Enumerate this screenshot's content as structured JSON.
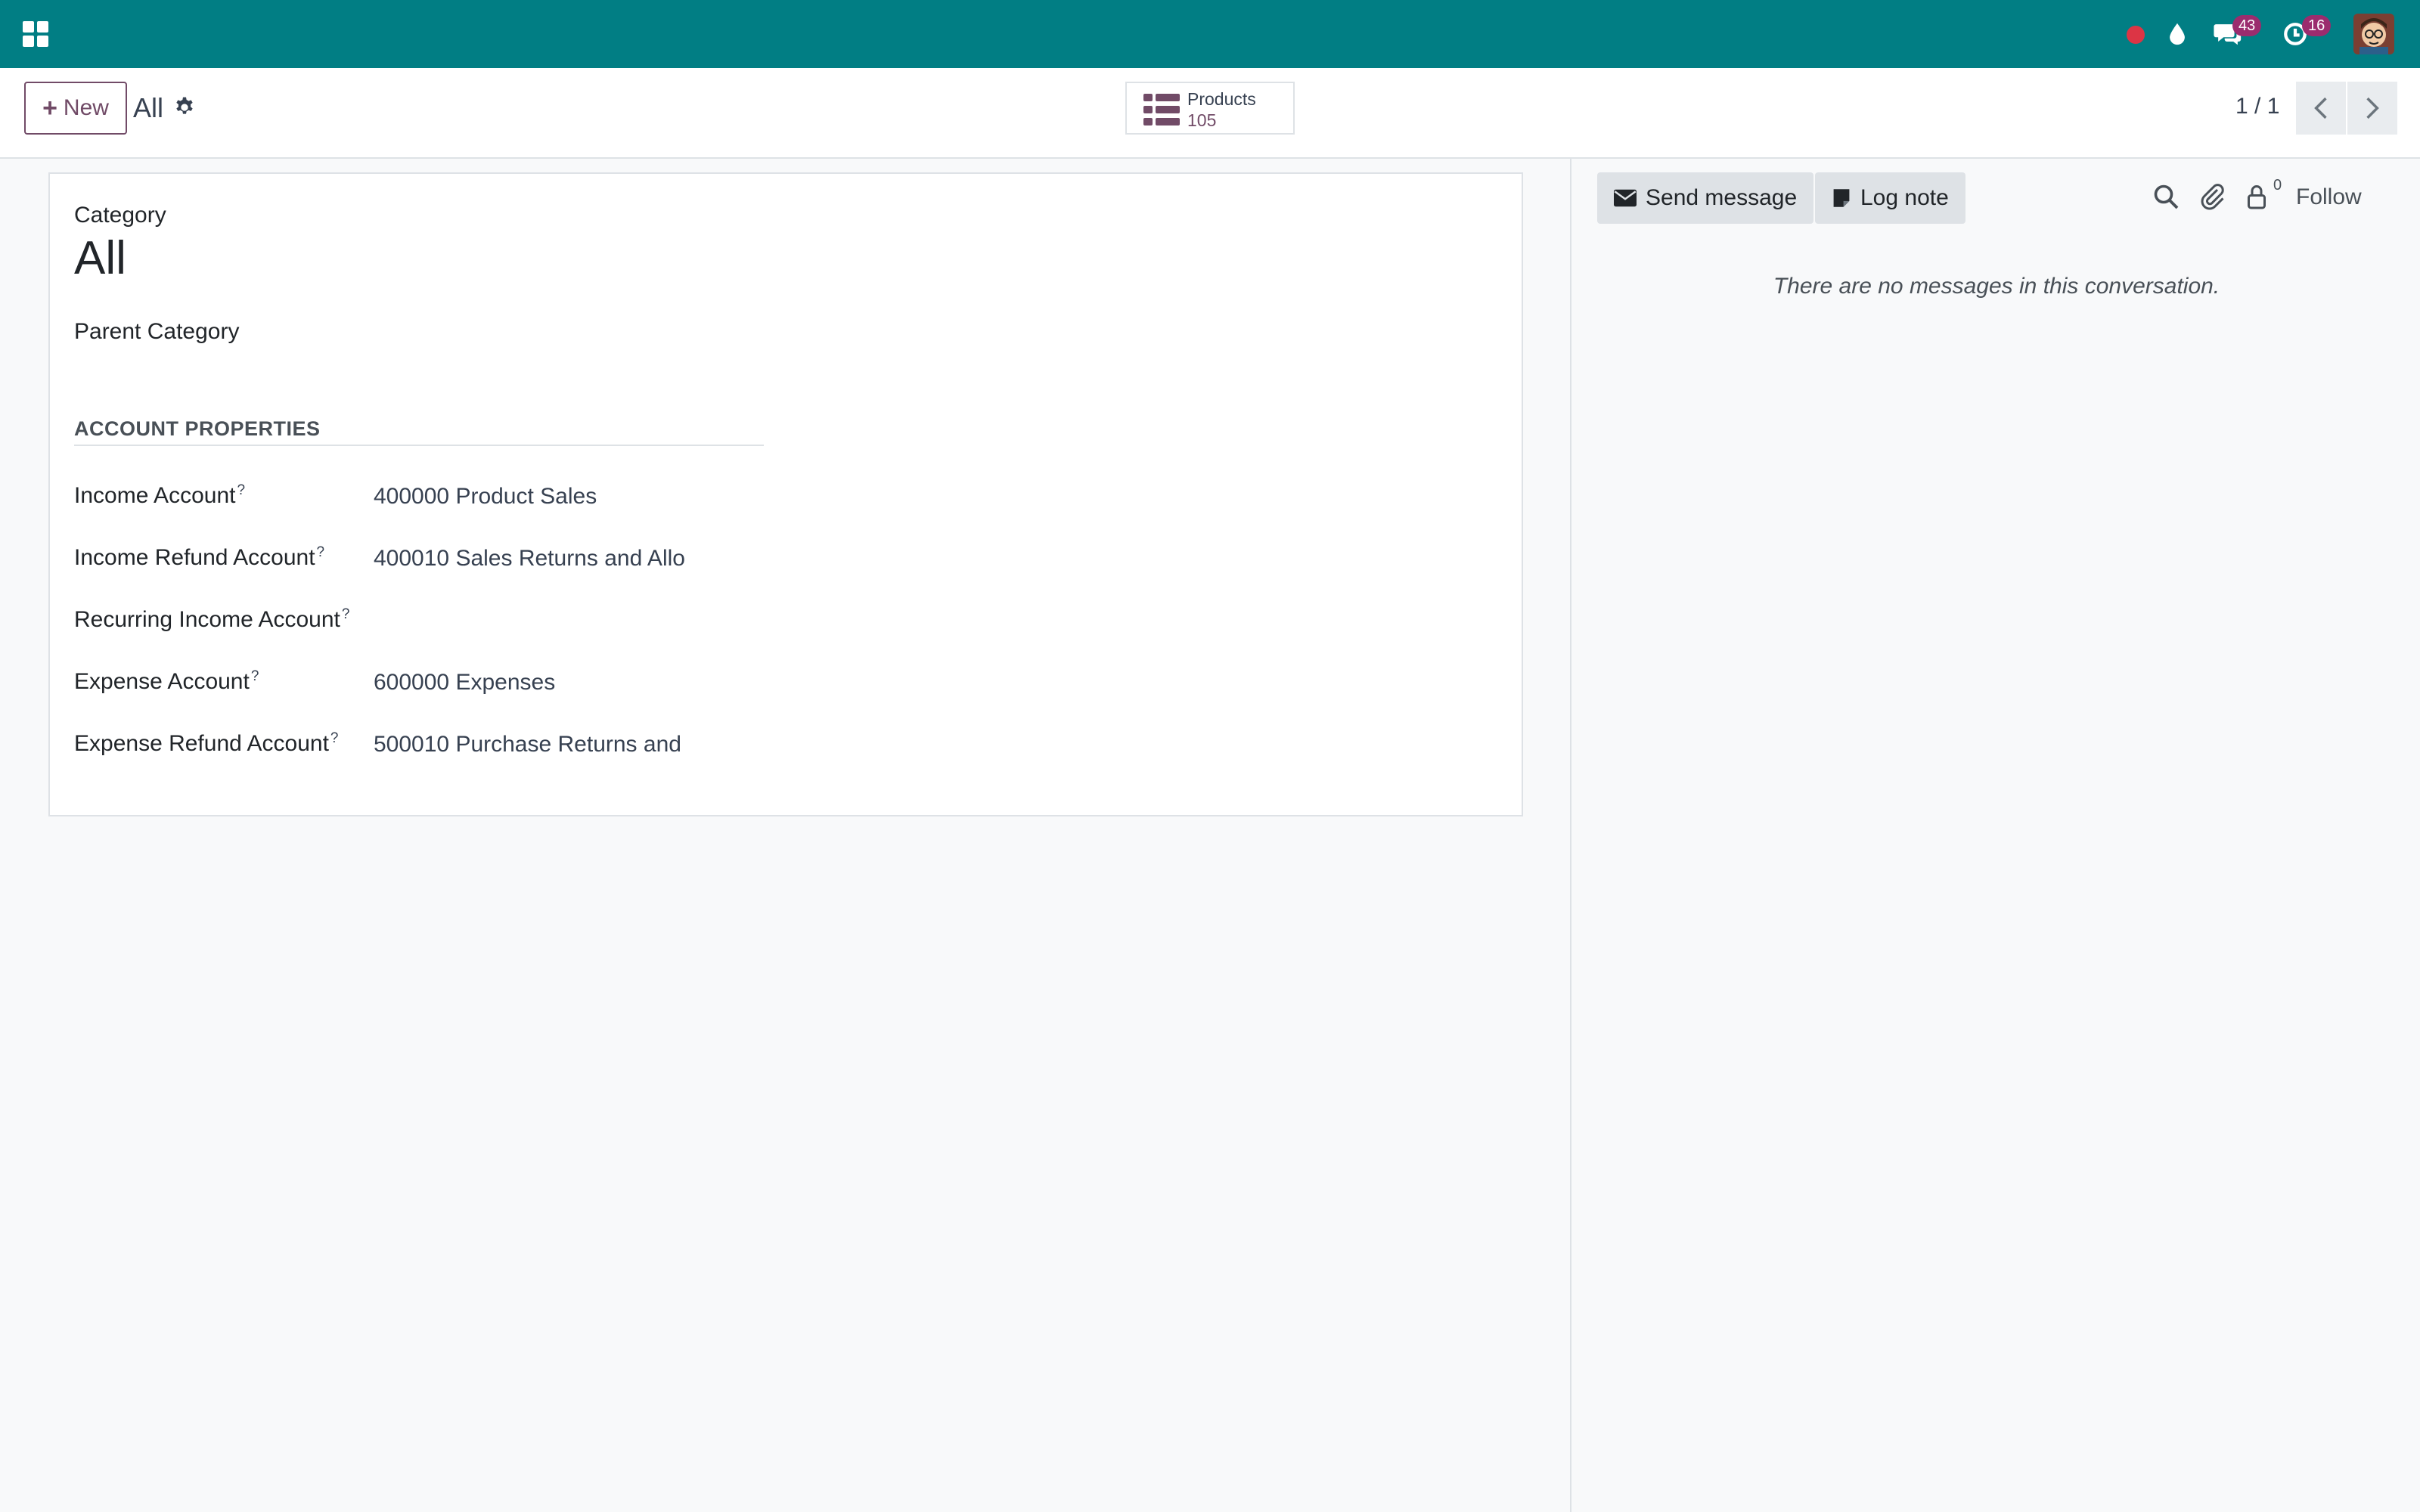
{
  "topbar": {
    "apps_icon": "apps-grid-icon",
    "recording_icon": "record-dot-icon",
    "recording_color": "#dc3545",
    "drop_icon": "water-drop-icon",
    "messages_icon": "chat-bubbles-icon",
    "messages_count": "43",
    "activities_icon": "clock-icon",
    "activities_count": "16",
    "badge_color": "#9b2c6e",
    "bar_color": "#017e84"
  },
  "control_panel": {
    "new_label": "New",
    "breadcrumb": "All",
    "gear_icon": "gear-icon",
    "smart_button": {
      "label": "Products",
      "count": "105",
      "icon": "list-icon"
    },
    "pager": "1 / 1",
    "prev_icon": "chevron-left-icon",
    "next_icon": "chevron-right-icon",
    "accent_color": "#714b67"
  },
  "form": {
    "category_label": "Category",
    "category_value": "All",
    "parent_label": "Parent Category",
    "parent_value": "",
    "section_title": "ACCOUNT PROPERTIES",
    "rows": [
      {
        "label": "Income Account",
        "help": "?",
        "value": "400000 Product Sales"
      },
      {
        "label": "Income Refund Account",
        "help": "?",
        "value": "400010 Sales Returns and Allo"
      },
      {
        "label": "Recurring Income Account",
        "help": "?",
        "value": ""
      },
      {
        "label": "Expense Account",
        "help": "?",
        "value": "600000 Expenses"
      },
      {
        "label": "Expense Refund Account",
        "help": "?",
        "value": "500010 Purchase Returns and"
      }
    ]
  },
  "chatter": {
    "send_message": "Send message",
    "log_note": "Log note",
    "search_icon": "search-icon",
    "attachment_icon": "paperclip-icon",
    "followers_icon": "user-lock-icon",
    "followers_count": "0",
    "follow": "Follow",
    "empty_text": "There are no messages in this conversation."
  }
}
